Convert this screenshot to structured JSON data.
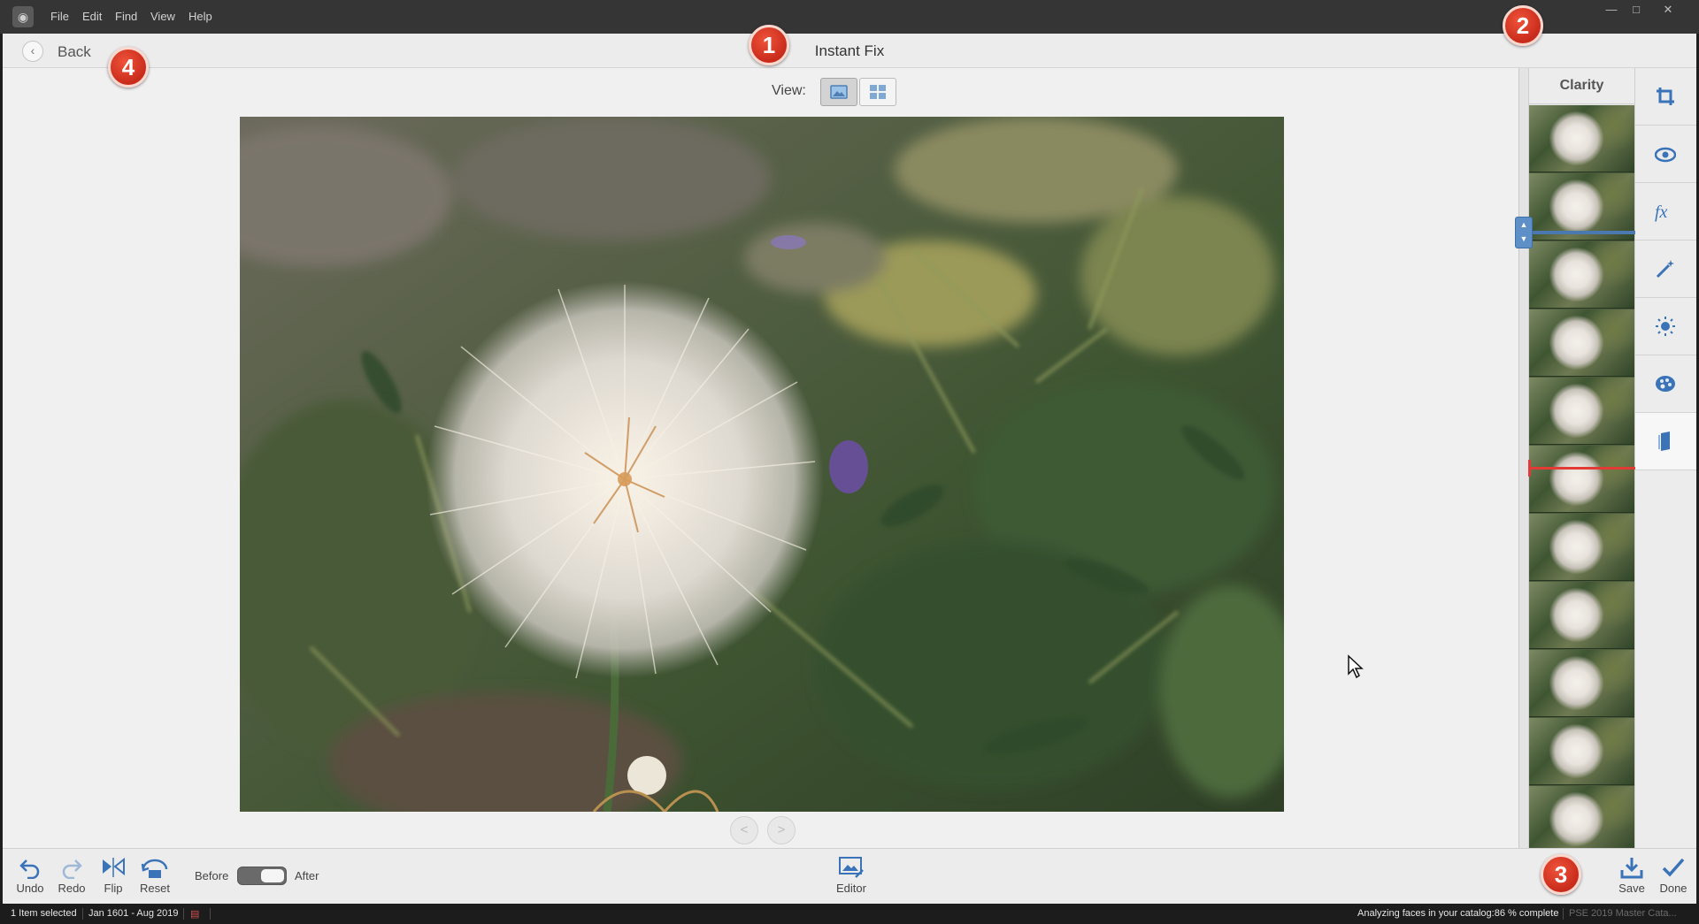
{
  "window": {
    "menu": [
      "File",
      "Edit",
      "Find",
      "View",
      "Help"
    ],
    "controls": [
      "minimize-icon",
      "maximize-icon",
      "close-icon"
    ]
  },
  "header": {
    "back_label": "Back",
    "title": "Instant Fix"
  },
  "main": {
    "view_label": "View:",
    "view_modes": [
      "single-photo-view-icon",
      "grid-view-icon"
    ],
    "active_view": "single-photo-view-icon",
    "nav": {
      "prev": "<",
      "next": ">"
    }
  },
  "filmstrip": {
    "title": "Clarity",
    "thumbnail_count": 11,
    "selected_index": 1,
    "colors": {
      "selection": "#4c78b0",
      "current": "#e23b35"
    }
  },
  "tools": [
    {
      "name": "crop-icon",
      "active": false
    },
    {
      "name": "red-eye-icon",
      "active": false
    },
    {
      "name": "effects-fx-icon",
      "active": false
    },
    {
      "name": "smart-fix-wand-icon",
      "active": false
    },
    {
      "name": "light-sun-icon",
      "active": false
    },
    {
      "name": "color-palette-icon",
      "active": false
    },
    {
      "name": "clarity-icon",
      "active": true
    }
  ],
  "bottom": {
    "undo": "Undo",
    "redo": "Redo",
    "flip": "Flip",
    "reset": "Reset",
    "before": "Before",
    "after": "After",
    "toggle_state": "After",
    "editor": "Editor",
    "save": "Save",
    "done": "Done"
  },
  "status": {
    "selected": "1 Item selected",
    "date_range": "Jan 1601 - Aug 2019",
    "analyzing": "Analyzing faces in your catalog:86 % complete",
    "catalog": "PSE 2019 Master Cata..."
  },
  "callouts": [
    "1",
    "2",
    "3",
    "4"
  ],
  "colors": {
    "accent": "#4c78b0",
    "callout": "#d63a24"
  }
}
